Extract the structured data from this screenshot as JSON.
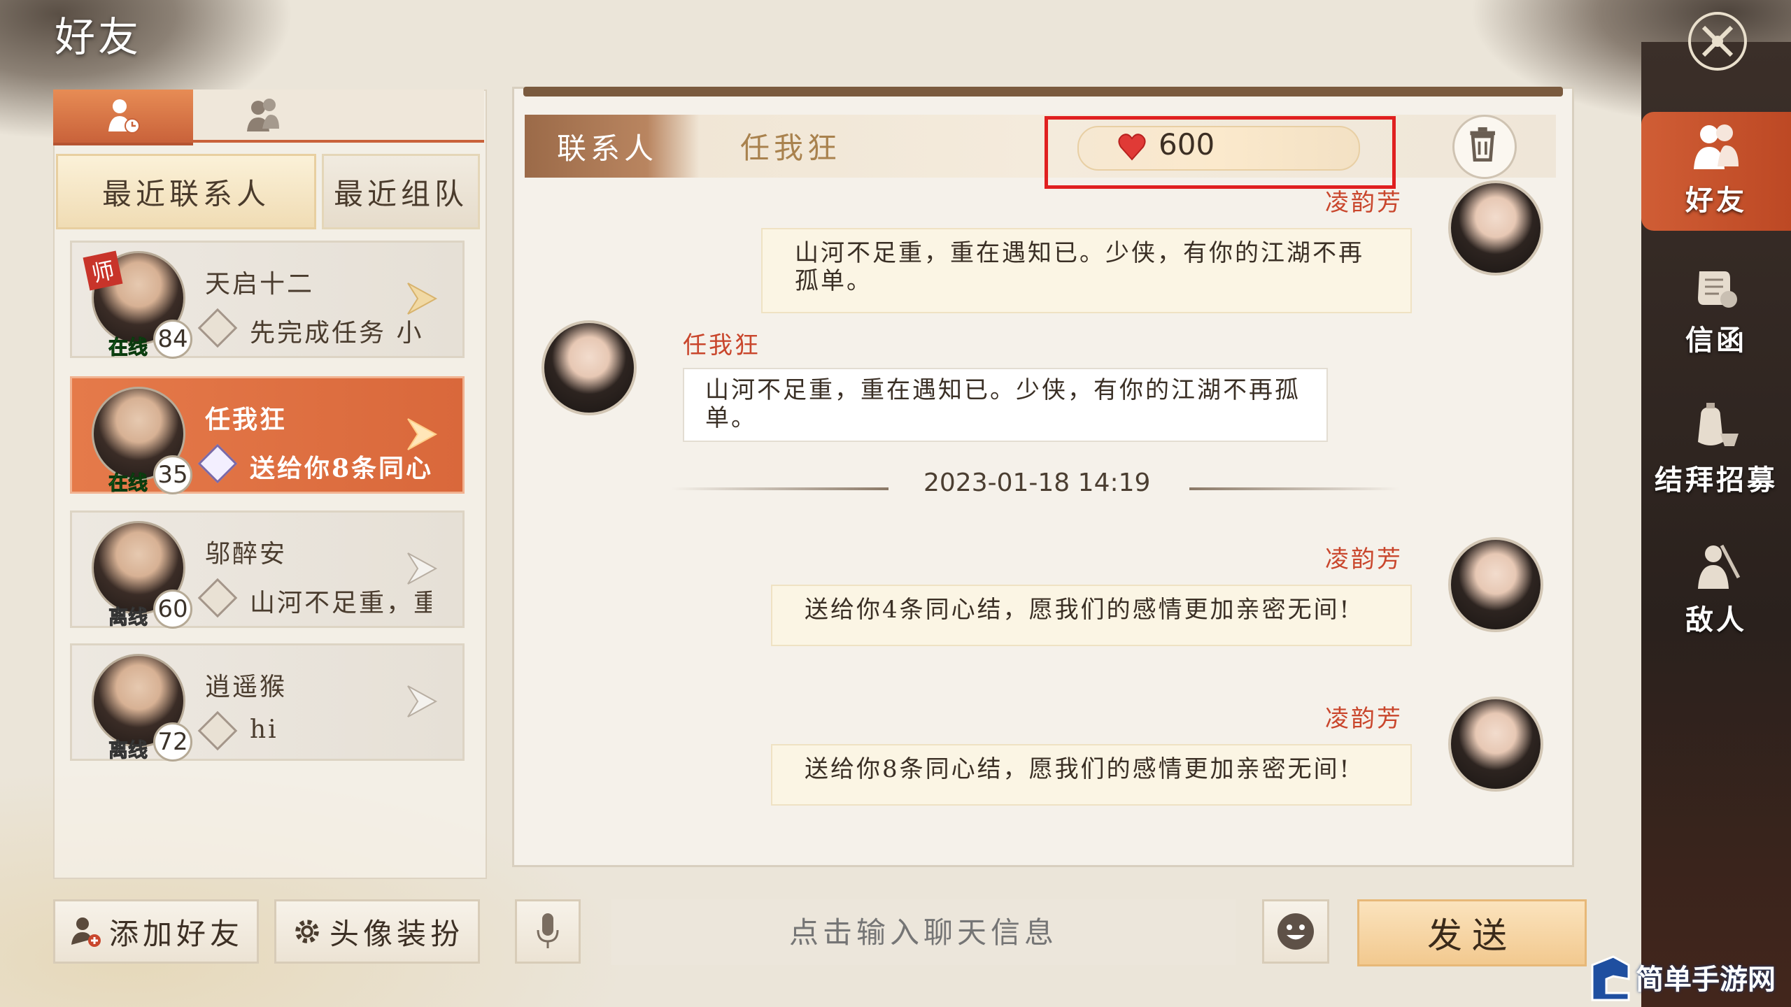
{
  "title": "好友",
  "left_panel": {
    "tabs": [
      {
        "icon": "recent-contacts-icon"
      },
      {
        "icon": "groups-icon"
      }
    ],
    "subtabs": {
      "recent": "最近联系人",
      "team": "最近组队"
    },
    "contacts": [
      {
        "name": "天启十二",
        "level": "84",
        "status": "在线",
        "message": "先完成任务 小",
        "badge": "师"
      },
      {
        "name": "任我狂",
        "level": "35",
        "status": "在线",
        "message": "送给你8条同心结"
      },
      {
        "name": "邬醉安",
        "level": "60",
        "status": "离线",
        "message": "山河不足重，重"
      },
      {
        "name": "逍遥猴",
        "level": "72",
        "status": "离线",
        "message": "hi"
      }
    ]
  },
  "chat": {
    "contact_label": "联系人",
    "contact_name": "任我狂",
    "intimacy": "600",
    "messages": [
      {
        "sender": "凌韵芳",
        "text": "山河不足重，重在遇知已。少侠，有你的江湖不再孤单。",
        "direction": "out"
      },
      {
        "sender": "任我狂",
        "text": "山河不足重，重在遇知已。少侠，有你的江湖不再孤单。",
        "direction": "in"
      },
      {
        "sender": "凌韵芳",
        "text": "送给你4条同心结，愿我们的感情更加亲密无间!",
        "direction": "out"
      },
      {
        "sender": "凌韵芳",
        "text": "送给你8条同心结，愿我们的感情更加亲密无间!",
        "direction": "out"
      }
    ],
    "timestamp": "2023-01-18 14:19"
  },
  "bottom": {
    "add_friend": "添加好友",
    "avatar_dress": "头像装扮",
    "input_placeholder": "点击输入聊天信息",
    "send": "发送"
  },
  "right_nav": {
    "items": [
      {
        "label": "好友",
        "icon": "friends-icon"
      },
      {
        "label": "信函",
        "icon": "letters-icon"
      },
      {
        "label": "结拜招募",
        "icon": "sworn-recruit-icon"
      },
      {
        "label": "敌人",
        "icon": "enemy-icon"
      }
    ]
  },
  "watermark": "简单手游网",
  "colors": {
    "accent": "#d9683b",
    "highlight": "#e02020",
    "online": "#29d63e"
  }
}
